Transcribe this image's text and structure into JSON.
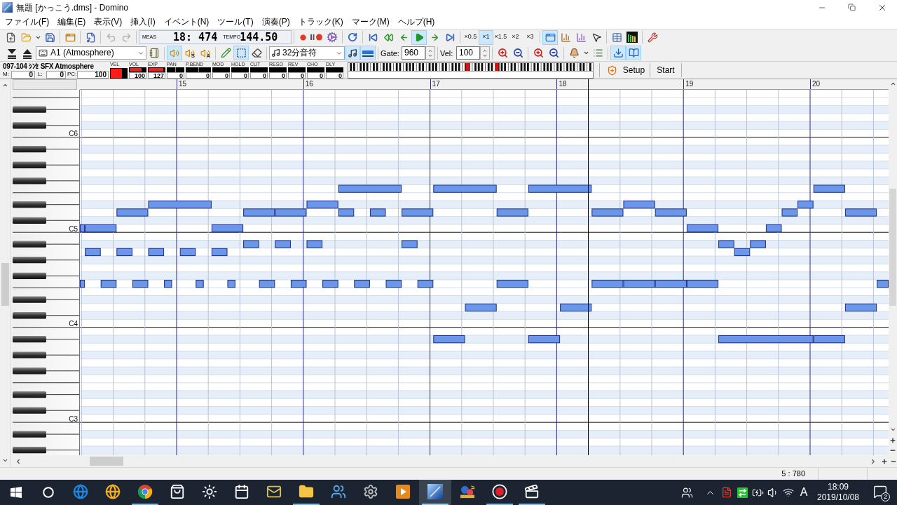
{
  "window": {
    "title": "無題 [かっこう.dms] - Domino"
  },
  "menu": [
    "ファイル(F)",
    "編集(E)",
    "表示(V)",
    "挿入(I)",
    "イベント(N)",
    "ツール(T)",
    "演奏(P)",
    "トラック(K)",
    "マーク(M)",
    "ヘルプ(H)"
  ],
  "toolbar": {
    "history": [
      {
        "disabled": true
      },
      {
        "disabled": true
      }
    ],
    "position": {
      "meas_label": "MEAS",
      "meas": "18: 474",
      "tempo_label": "TEMPO",
      "tempo": "144.50"
    },
    "transport": [
      {
        "selected": false
      },
      {
        "selected": false
      },
      {
        "selected": false
      },
      {
        "selected": true
      },
      {
        "selected": false
      },
      {
        "selected": false
      }
    ],
    "speeds": [
      {
        "label": "×0.5",
        "selected": false
      },
      {
        "label": "×1",
        "selected": true
      },
      {
        "label": "×1.5",
        "selected": false
      },
      {
        "label": "×2",
        "selected": false
      },
      {
        "label": "×3",
        "selected": false
      }
    ],
    "views": [
      {
        "selected": true
      },
      {
        "selected": false
      },
      {
        "selected": false
      },
      {
        "selected": false
      }
    ]
  },
  "toolbar2": {
    "track": "A1 (Atmosphere)",
    "mute_modes": [
      {
        "selected": true
      },
      {
        "label": "S",
        "selected": false
      },
      {
        "label": "A",
        "selected": false
      }
    ],
    "tools": [
      {
        "selected": false
      },
      {
        "selected": true
      },
      {
        "selected": false
      }
    ],
    "note_length": "32分音符",
    "snap": [
      {
        "selected": true
      },
      {
        "selected": true
      }
    ],
    "gate_label": "Gate:",
    "gate": "960",
    "vel_label": "Vel:",
    "vel": "100",
    "panes": [
      {
        "selected": true
      },
      {
        "selected": true
      }
    ]
  },
  "track_info": {
    "name": "097-104 ｼﾝｾ SFX Atmosphere",
    "fields": [
      {
        "label": "M:",
        "value": "0"
      },
      {
        "label": "L:",
        "value": "0"
      },
      {
        "label": "PC:",
        "value": "100"
      }
    ],
    "meters": [
      {
        "label": "VEL",
        "kind": "velocity",
        "level": 0.78
      },
      {
        "label": "VOL",
        "kind": "level",
        "value": "100",
        "level": 0.79
      },
      {
        "label": "EXP",
        "kind": "level",
        "value": "127",
        "level": 1
      },
      {
        "label": "PAN",
        "kind": "pan",
        "value": "0"
      },
      {
        "label": "P.BEND",
        "kind": "bend",
        "value": "0"
      },
      {
        "label": "MOD",
        "kind": "level",
        "value": "0"
      },
      {
        "label": "HOLD",
        "kind": "level",
        "value": "0"
      },
      {
        "label": "CUT",
        "kind": "level",
        "value": "0"
      },
      {
        "label": "RESO",
        "kind": "level",
        "value": "0"
      },
      {
        "label": "REV",
        "kind": "level",
        "value": "0"
      },
      {
        "label": "CHO",
        "kind": "level",
        "value": "0"
      },
      {
        "label": "DLY",
        "kind": "level",
        "value": "0"
      }
    ],
    "buttons": [
      "Setup",
      "Start"
    ]
  },
  "ruler": {
    "measures": [
      "15",
      "16",
      "17",
      "18",
      "19",
      "20"
    ]
  },
  "keyboard": {
    "octave_labels": [
      "C6",
      "C5",
      "C4",
      "C3"
    ]
  },
  "status_bar": {
    "position": "5 : 780"
  },
  "taskbar": {
    "apps": [
      {
        "running": false,
        "selected": false
      },
      {
        "running": false,
        "selected": false
      },
      {
        "running": true,
        "selected": false
      },
      {
        "running": false,
        "selected": false
      },
      {
        "running": false,
        "selected": false
      },
      {
        "running": false,
        "selected": false
      },
      {
        "running": false,
        "selected": false
      },
      {
        "running": true,
        "selected": false
      },
      {
        "running": false,
        "selected": false
      },
      {
        "running": false,
        "selected": false
      },
      {
        "running": false,
        "selected": false
      },
      {
        "running": true,
        "selected": true
      },
      {
        "running": false,
        "selected": false
      },
      {
        "running": true,
        "selected": false
      },
      {
        "running": true,
        "selected": false
      }
    ],
    "ime": "A",
    "time": "18:09",
    "date": "2019/10/08",
    "notifications": "2"
  }
}
